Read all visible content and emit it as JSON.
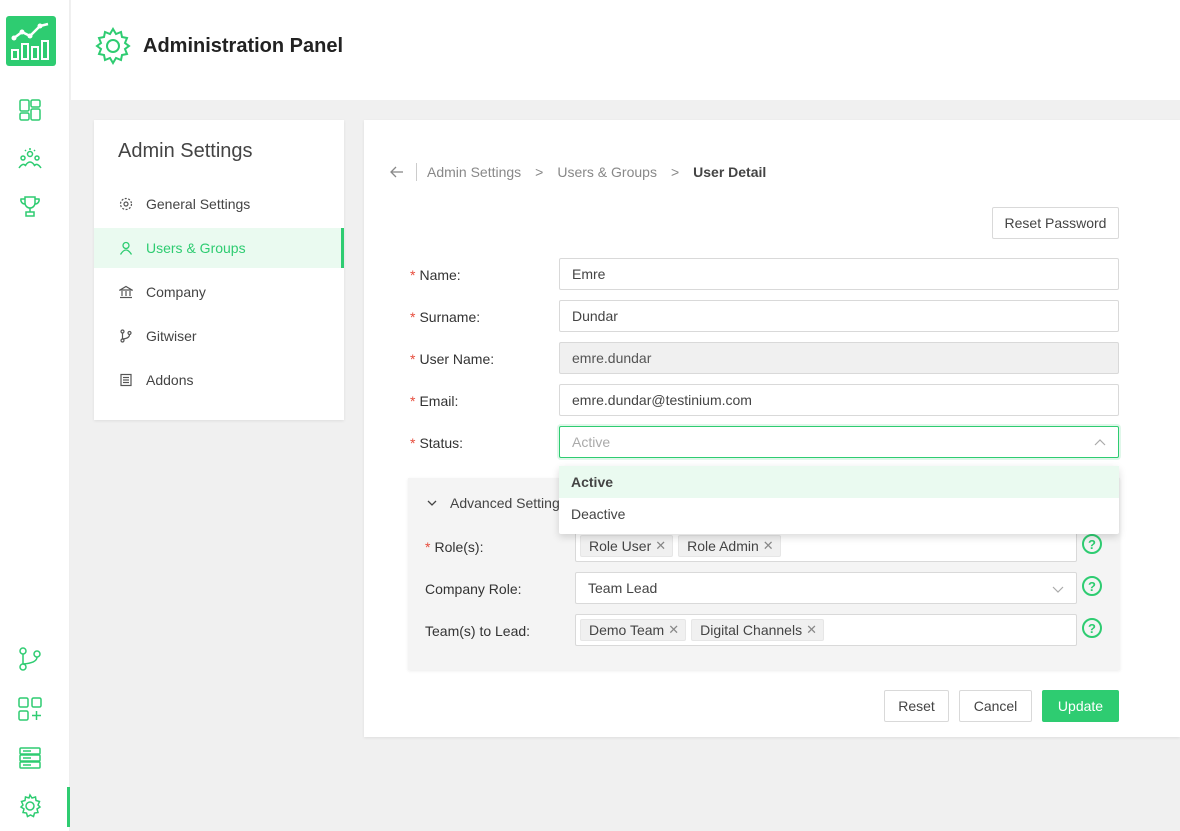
{
  "app": {
    "header_title": "Administration Panel",
    "accent_color": "#2ecc71",
    "rail_icons": [
      "logo-chart-icon",
      "dashboard-icon",
      "team-icon",
      "trophy-icon",
      "git-branch-icon",
      "add-app-icon",
      "server-icon",
      "settings-gear-icon"
    ]
  },
  "menu": {
    "title": "Admin Settings",
    "items": [
      {
        "label": "General Settings",
        "icon": "gear-icon"
      },
      {
        "label": "Users & Groups",
        "icon": "user-icon",
        "active": true
      },
      {
        "label": "Company",
        "icon": "bank-icon"
      },
      {
        "label": "Gitwiser",
        "icon": "git-branch-icon"
      },
      {
        "label": "Addons",
        "icon": "book-icon"
      }
    ]
  },
  "breadcrumb": {
    "items": [
      "Admin Settings",
      "Users & Groups",
      "User Detail"
    ],
    "separator": ">"
  },
  "actions": {
    "reset_password": "Reset Password",
    "reset": "Reset",
    "cancel": "Cancel",
    "update": "Update"
  },
  "form": {
    "name_label": "Name:",
    "name_value": "Emre",
    "surname_label": "Surname:",
    "surname_value": "Dundar",
    "username_label": "User Name:",
    "username_value": "emre.dundar",
    "email_label": "Email:",
    "email_value": "emre.dundar@testinium.com",
    "status_label": "Status:",
    "status_value": "Active",
    "status_options": [
      "Active",
      "Deactive"
    ]
  },
  "advanced": {
    "title": "Advanced Settings",
    "roles_label": "Role(s):",
    "roles": [
      "Role User",
      "Role Admin"
    ],
    "company_role_label": "Company Role:",
    "company_role_value": "Team Lead",
    "teams_label": "Team(s) to Lead:",
    "teams": [
      "Demo Team",
      "Digital Channels"
    ],
    "help_glyph": "?"
  }
}
